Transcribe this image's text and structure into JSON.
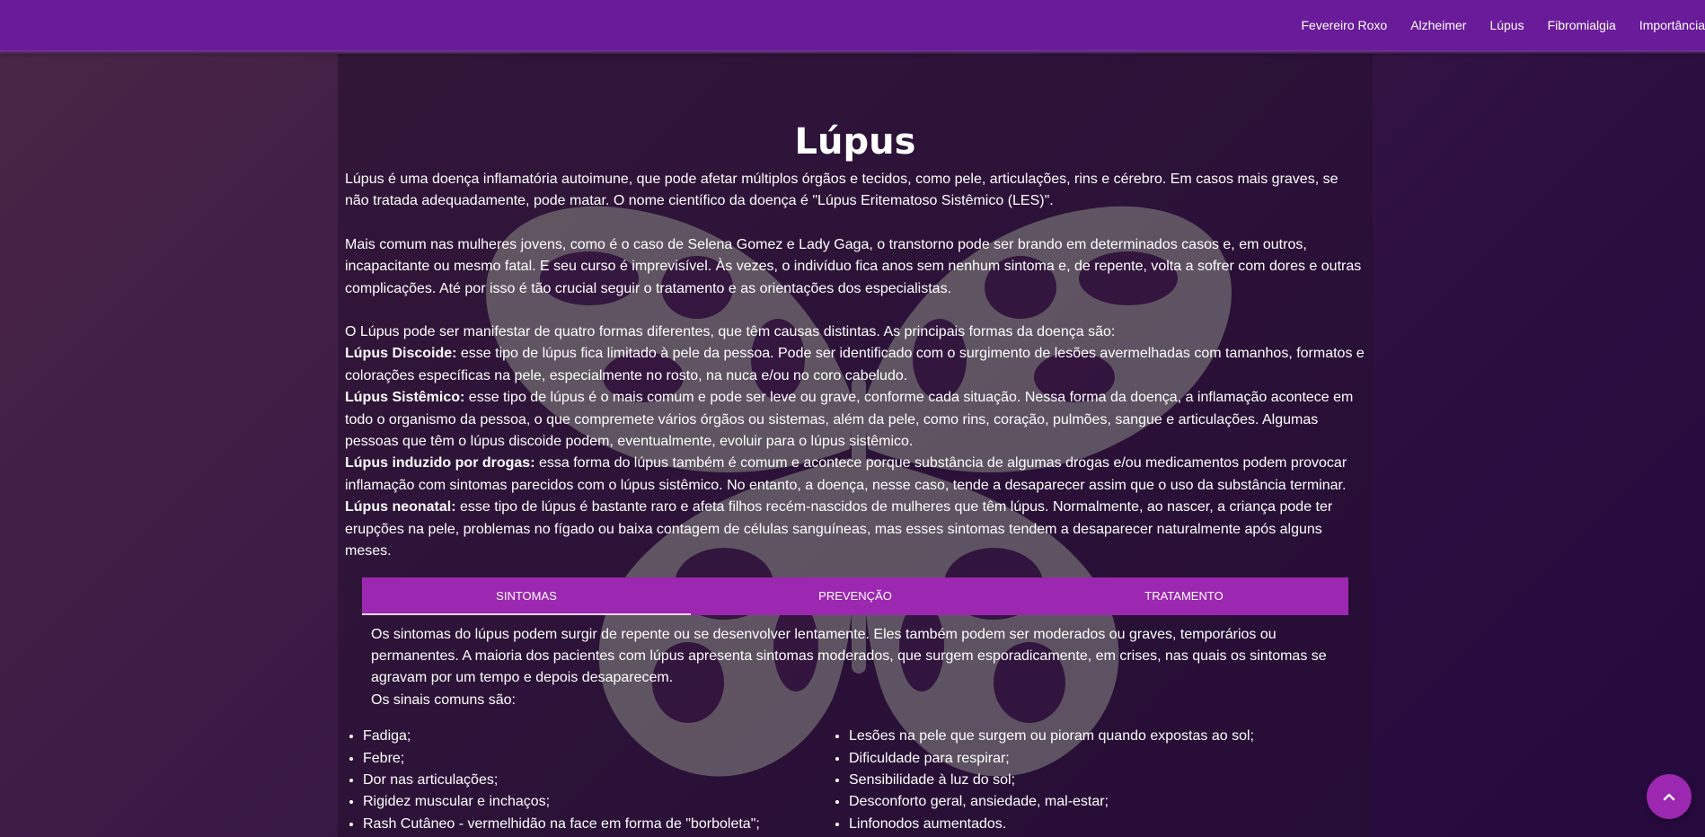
{
  "nav": {
    "items": [
      "Fevereiro Roxo",
      "Alzheimer",
      "Lúpus",
      "Fibromialgia",
      "Importância"
    ]
  },
  "page": {
    "title": "Lúpus",
    "p1": "Lúpus é uma doença inflamatória autoimune, que pode afetar múltiplos órgãos e tecidos, como pele, articulações, rins e cérebro. Em casos mais graves, se não tratada adequadamente, pode matar. O nome científico da doença é \"Lúpus Eritematoso Sistêmico (LES)\".",
    "p2": "Mais comum nas mulheres jovens, como é o caso de Selena Gomez e Lady Gaga, o transtorno pode ser brando em determinados casos e, em outros, incapacitante ou mesmo fatal. E seu curso é imprevisível. Às vezes, o indivíduo fica anos sem nenhum sintoma e, de repente, volta a sofrer com dores e outras complicações. Até por isso é tão crucial seguir o tratamento e as orientações dos especialistas.",
    "p3_intro": "O Lúpus pode ser manifestar de quatro formas diferentes, que têm causas distintas. As principais formas da doença são:",
    "forms": [
      {
        "name": "Lúpus Discoide:",
        "text": " esse tipo de lúpus fica limitado à pele da pessoa. Pode ser identificado com o surgimento de lesões avermelhadas com tamanhos, formatos e colorações específicas na pele, especialmente no rosto, na nuca e/ou no coro cabeludo."
      },
      {
        "name": "Lúpus Sistêmico:",
        "text": " esse tipo de lúpus é o mais comum e pode ser leve ou grave, conforme cada situação. Nessa forma da doença, a inflamação acontece em todo o organismo da pessoa, o que compremete vários órgãos ou sistemas, além da pele, como rins, coração, pulmões, sangue e articulações. Algumas pessoas que têm o lúpus discoide podem, eventualmente, evoluir para o lúpus sistêmico."
      },
      {
        "name": "Lúpus induzido por drogas:",
        "text": " essa forma do lúpus também é comum e acontece porque substância de algumas drogas e/ou medicamentos podem provocar inflamação com sintomas parecidos com o lúpus sistêmico. No entanto, a doença, nesse caso, tende a desaparecer assim que o uso da substância terminar."
      },
      {
        "name": "Lúpus neonatal:",
        "text": " esse tipo de lúpus é bastante raro e afeta filhos recém-nascidos de mulheres que têm lúpus. Normalmente, ao nascer, a criança pode ter erupções na pele, problemas no fígado ou baixa contagem de células sanguíneas, mas esses sintomas tendem a desaparecer naturalmente após alguns meses."
      }
    ]
  },
  "tabs": {
    "labels": [
      "SINTOMAS",
      "PREVENÇÃO",
      "TRATAMENTO"
    ],
    "active_index": 0,
    "sintomas": {
      "text": "Os sintomas do lúpus podem surgir de repente ou se desenvolver lentamente. Eles também podem ser moderados ou graves, temporários ou permanentes. A maioria dos pacientes com lúpus apresenta sintomas moderados, que surgem esporadicamente, em crises, nas quais os sintomas se agravam por um tempo e depois desaparecem.",
      "signs_intro": "Os sinais comuns são:",
      "list_left": [
        "Fadiga;",
        "Febre;",
        "Dor nas articulações;",
        "Rigidez muscular e inchaços;",
        "Rash Cutâneo - vermelhidão na face em forma de \"borboleta\";"
      ],
      "list_right": [
        "Lesões na pele que surgem ou pioram quando expostas ao sol;",
        "Dificuldade para respirar;",
        "Sensibilidade à luz do sol;",
        "Desconforto geral, ansiedade, mal-estar;",
        "Linfonodos aumentados."
      ]
    }
  },
  "icons": {
    "back_to_top": "chevron-up-icon",
    "background": "butterfly-icon"
  },
  "colors": {
    "navbar": "#6a1b9a",
    "tabs_bar": "#9c27b0",
    "back_to_top": "#9c27b0"
  }
}
